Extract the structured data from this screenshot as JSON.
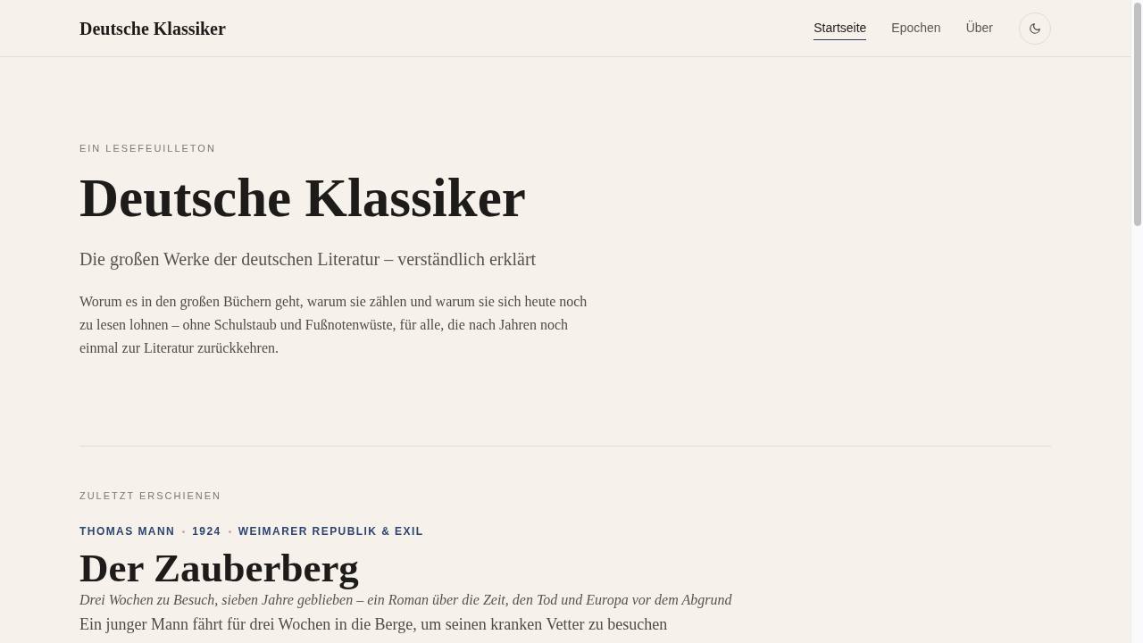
{
  "header": {
    "logo": "Deutsche Klassiker",
    "nav": [
      {
        "label": "Startseite",
        "selected": true
      },
      {
        "label": "Epochen",
        "selected": false
      },
      {
        "label": "Über",
        "selected": false
      }
    ]
  },
  "hero": {
    "eyebrow": "EIN LESEFEUILLETON",
    "title": "Deutsche Klassiker",
    "subtitle": "Die großen Werke der deutschen Literatur – verständlich erklärt",
    "intro": "Worum es in den großen Büchern geht, warum sie zählen und warum sie sich heute noch zu lesen lohnen – ohne Schulstaub und Fußnotenwüste, für alle, die nach Jahren noch einmal zur Literatur zurückkehren."
  },
  "latest": {
    "eyebrow": "ZULETZT ERSCHIENEN",
    "meta": [
      "THOMAS MANN",
      "1924",
      "WEIMARER REPUBLIK & EXIL"
    ],
    "title": "Der Zauberberg",
    "tagline": "Drei Wochen zu Besuch, sieben Jahre geblieben – ein Roman über die Zeit, den Tod und Europa vor dem Abgrund",
    "body": "Ein junger Mann fährt für drei Wochen in die Berge, um seinen kranken Vetter zu besuchen"
  }
}
